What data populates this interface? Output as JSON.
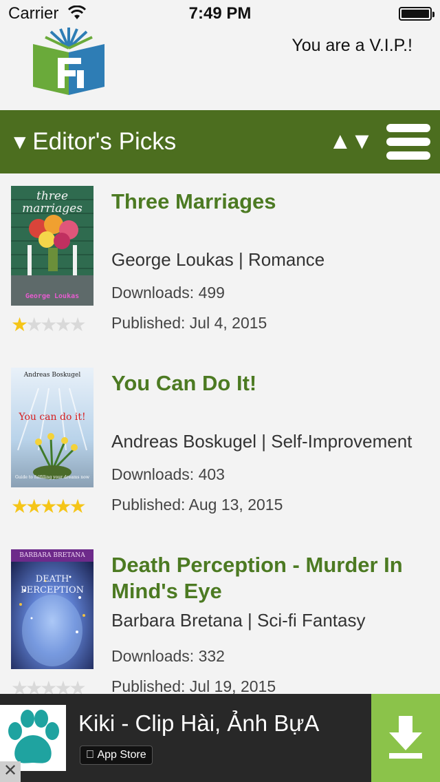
{
  "status_bar": {
    "carrier": "Carrier",
    "time": "7:49 PM"
  },
  "header": {
    "vip_text": "You are a V.I.P.!"
  },
  "category_bar": {
    "label": "▾ Editor's Picks",
    "sort_label": "▲▼"
  },
  "books": [
    {
      "title": "Three Marriages",
      "author_genre": "George Loukas | Romance",
      "downloads": "Downloads: 499",
      "published": "Published: Jul 4, 2015",
      "rating": 1,
      "cover": {
        "top_text": "three marriages",
        "bottom_text": "George Loukas",
        "bg": "#2f6b4f"
      }
    },
    {
      "title": "You Can Do It!",
      "author_genre": "Andreas Boskugel | Self-Improvement",
      "downloads": "Downloads: 403",
      "published": "Published: Aug 13, 2015",
      "rating": 5,
      "cover": {
        "top_text": "Andreas Boskugel",
        "mid_text": "You can do it!",
        "bottom_text": "Guide to fulfilling your dreams now",
        "bg": "#cfe1f2"
      }
    },
    {
      "title": "Death Perception - Murder In Mind's Eye",
      "author_genre": "Barbara Bretana | Sci-fi Fantasy",
      "downloads": "Downloads: 332",
      "published": "Published: Jul 19, 2015",
      "rating": 0,
      "cover": {
        "top_text": "BARBARA BRETANA",
        "mid_text": "DEATH PERCEPTION",
        "bg": "#2a3f7a"
      }
    }
  ],
  "ad": {
    "name": "Kiki - Clip Hài, Ảnh BựA",
    "store_label": "App Store"
  },
  "colors": {
    "accent": "#4c6e1f",
    "title": "#4c7a22",
    "star": "#f5c518",
    "ad_button": "#8bc34a"
  }
}
